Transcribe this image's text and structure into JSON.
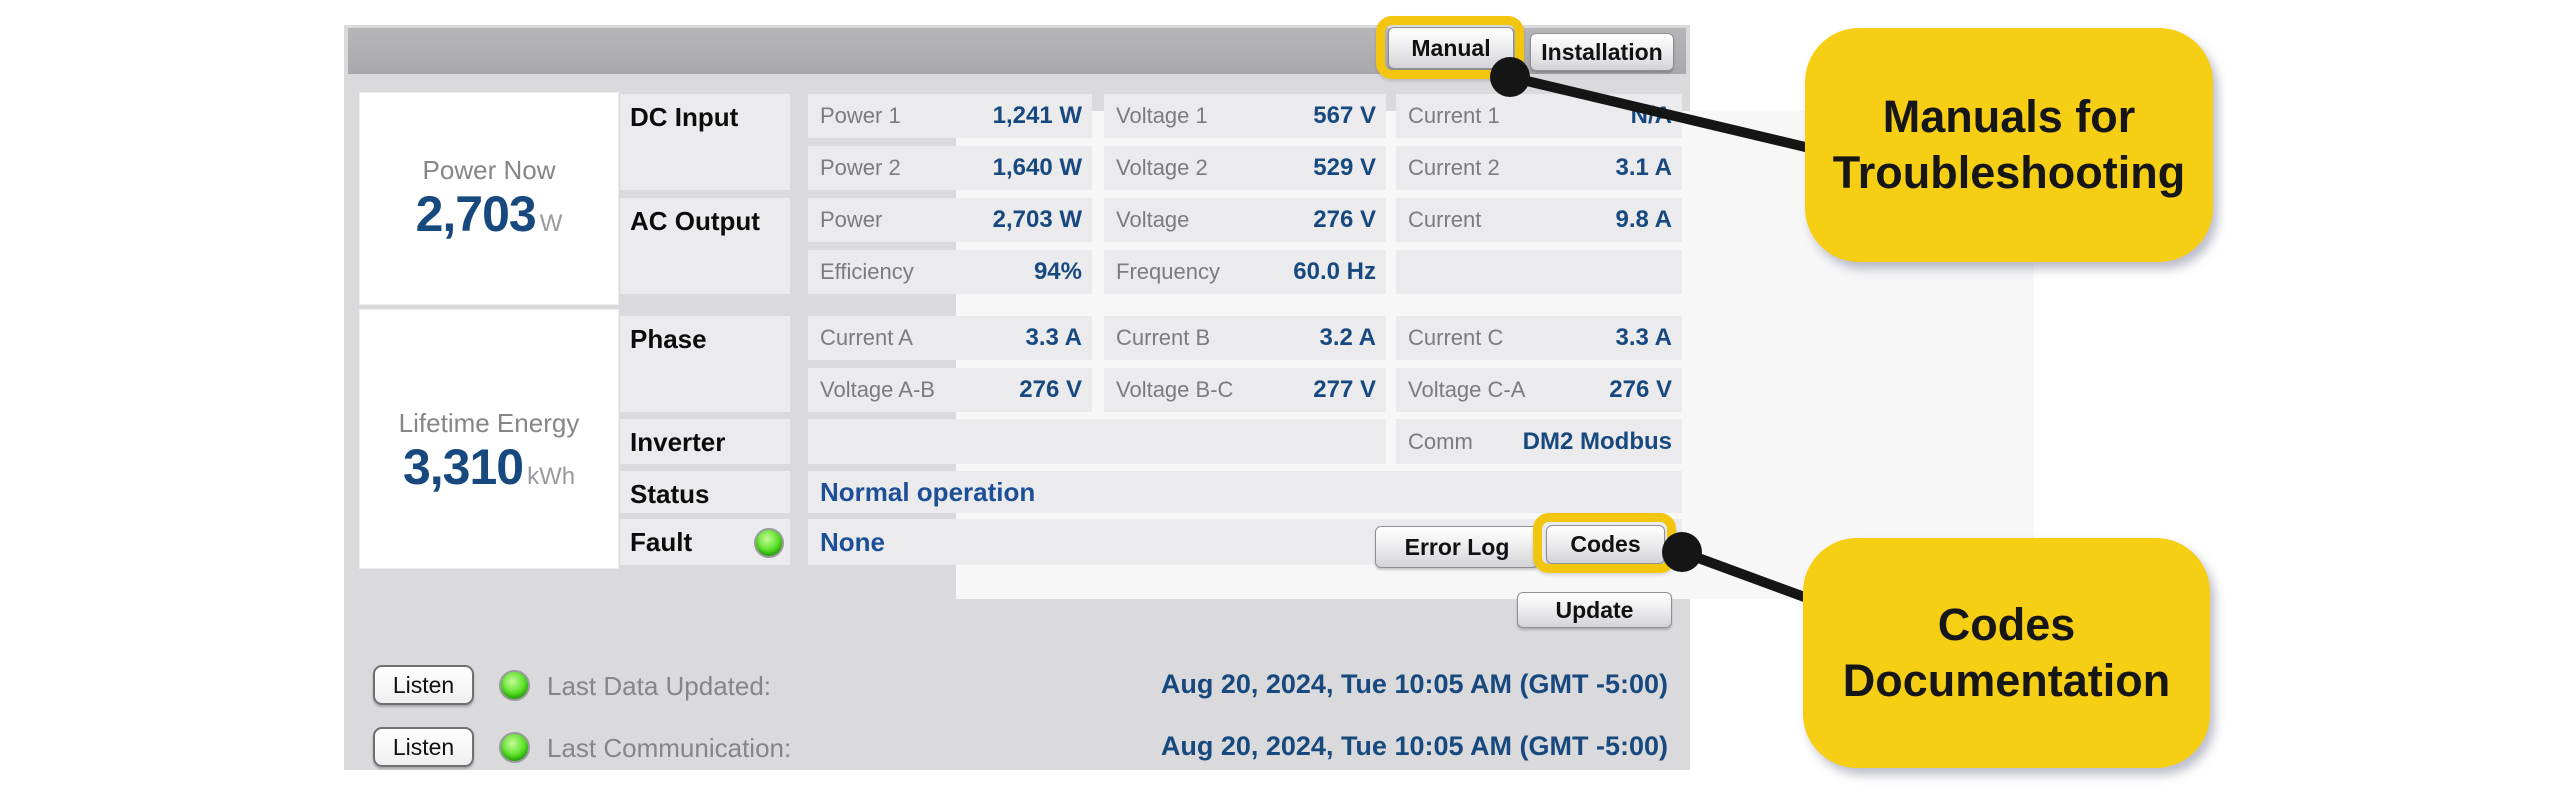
{
  "toolbar": {
    "manual": "Manual",
    "installation": "Installation"
  },
  "summary": {
    "power_now": {
      "label": "Power Now",
      "value": "2,703",
      "unit": "W"
    },
    "lifetime_energy": {
      "label": "Lifetime Energy",
      "value": "3,310",
      "unit": "kWh"
    }
  },
  "table": {
    "groups": [
      {
        "label": "DC Input"
      },
      {
        "label": "AC Output"
      },
      {
        "label": "Phase"
      },
      {
        "label": "Inverter"
      },
      {
        "label": "Status"
      },
      {
        "label": "Fault"
      }
    ],
    "cells": [
      {
        "label": "Power 1",
        "value": "1,241 W"
      },
      {
        "label": "Voltage 1",
        "value": "567 V"
      },
      {
        "label": "Current 1",
        "value": "N/A"
      },
      {
        "label": "Power 2",
        "value": "1,640 W"
      },
      {
        "label": "Voltage 2",
        "value": "529 V"
      },
      {
        "label": "Current 2",
        "value": "3.1 A"
      },
      {
        "label": "Power",
        "value": "2,703 W"
      },
      {
        "label": "Voltage",
        "value": "276 V"
      },
      {
        "label": "Current",
        "value": "9.8 A"
      },
      {
        "label": "Efficiency",
        "value": "94%"
      },
      {
        "label": "Frequency",
        "value": "60.0 Hz"
      },
      {
        "label": "Current A",
        "value": "3.3 A"
      },
      {
        "label": "Current B",
        "value": "3.2 A"
      },
      {
        "label": "Current C",
        "value": "3.3 A"
      },
      {
        "label": "Voltage A-B",
        "value": "276 V"
      },
      {
        "label": "Voltage B-C",
        "value": "277 V"
      },
      {
        "label": "Voltage C-A",
        "value": "276 V"
      },
      {
        "label": "Comm",
        "value": "DM2 Modbus"
      }
    ],
    "status_value": "Normal operation",
    "fault_value": "None"
  },
  "buttons": {
    "error_log": "Error Log",
    "codes": "Codes",
    "update": "Update",
    "listen": "Listen"
  },
  "footer": {
    "rows": [
      {
        "label": "Last Data Updated:",
        "timestamp": "Aug 20, 2024, Tue 10:05 AM (GMT -5:00)"
      },
      {
        "label": "Last Communication:",
        "timestamp": "Aug 20, 2024, Tue 10:05 AM (GMT -5:00)"
      }
    ]
  },
  "annotations": [
    {
      "line1": "Manuals for",
      "line2": "Troubleshooting"
    },
    {
      "line1": "Codes",
      "line2": "Documentation"
    }
  ],
  "colors": {
    "accent_yellow": "#f6cf15",
    "value_blue": "#17497f",
    "led_green": "#4ad41e",
    "panel_gray": "#dadadc",
    "topbar_gray": "#aeaeb1"
  }
}
